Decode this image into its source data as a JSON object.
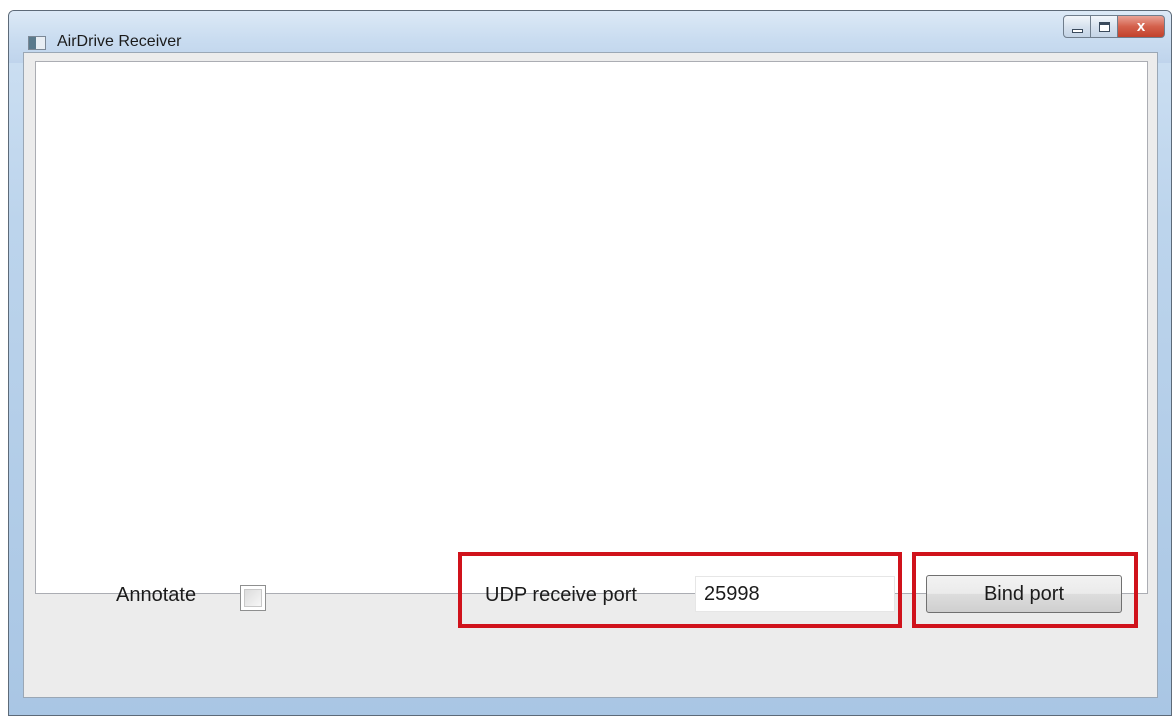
{
  "window": {
    "title": "AirDrive Receiver",
    "app_icon": "app-window-icon",
    "controls": {
      "minimize_icon": "minimize-icon",
      "maximize_icon": "maximize-icon",
      "close_icon": "close-icon",
      "close_glyph": "x"
    }
  },
  "main": {
    "annotate_label": "Annotate",
    "annotate_checked": false,
    "port_label": "UDP receive port",
    "port_value": "25998",
    "bind_button_label": "Bind port"
  },
  "colors": {
    "highlight": "#d0121b",
    "client_background": "#ececec",
    "close_button": "#c2412b"
  }
}
